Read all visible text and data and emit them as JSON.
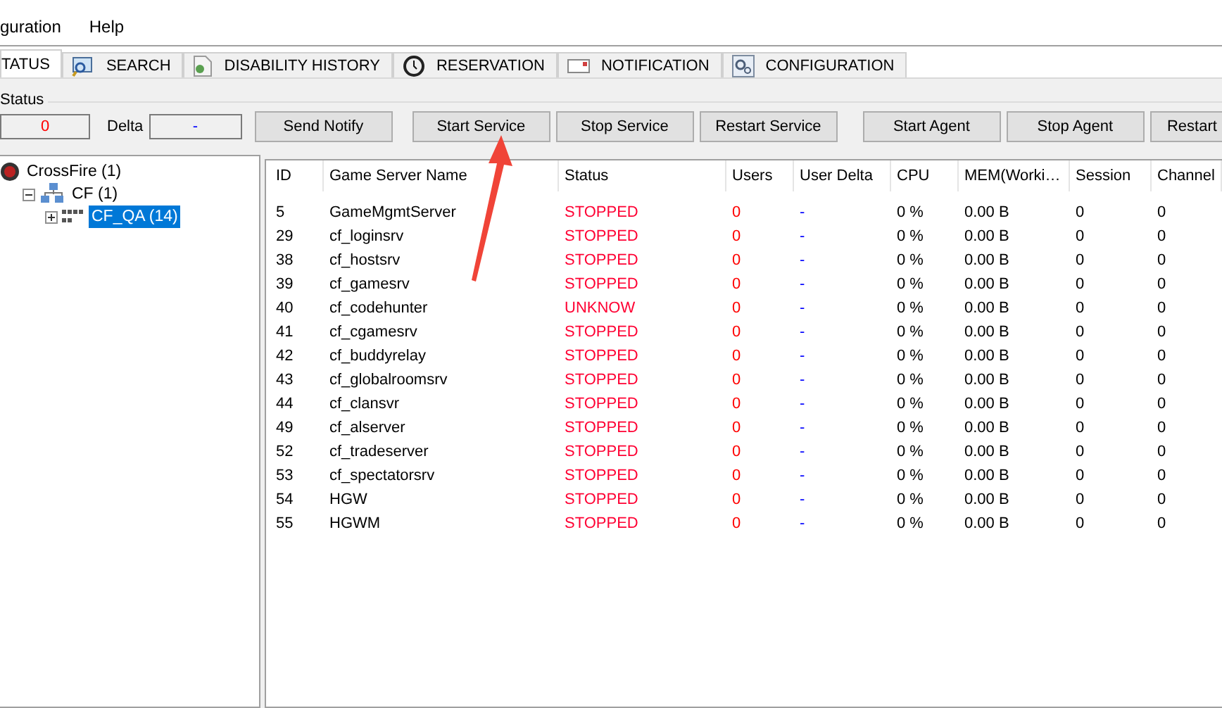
{
  "menu": [
    "guration",
    "Help"
  ],
  "tabs": [
    {
      "label": "TATUS",
      "selected": true
    },
    {
      "label": "SEARCH",
      "selected": false
    },
    {
      "label": "DISABILITY HISTORY",
      "selected": false
    },
    {
      "label": "RESERVATION",
      "selected": false
    },
    {
      "label": "NOTIFICATION",
      "selected": false
    },
    {
      "label": "CONFIGURATION",
      "selected": false
    }
  ],
  "status_group": {
    "title": "Status",
    "count": "0",
    "delta_label": "Delta",
    "delta": "-"
  },
  "buttons": [
    "Send Notify",
    "Start Service",
    "Stop Service",
    "Restart Service",
    "Start Agent",
    "Stop Agent",
    "Restart"
  ],
  "tree": [
    {
      "label": "CrossFire (1)",
      "selected": false,
      "children": [
        {
          "label": "CF (1)",
          "expanded": true,
          "selected": false,
          "children": [
            {
              "label": "CF_QA (14)",
              "expanded": false,
              "selected": true
            }
          ]
        }
      ]
    }
  ],
  "table": {
    "columns": [
      "ID",
      "Game Server Name",
      "Status",
      "Users",
      "User Delta",
      "CPU",
      "MEM(Worki…",
      "Session",
      "Channel"
    ],
    "rows": [
      [
        "5",
        "GameMgmtServer",
        "STOPPED",
        "0",
        "-",
        "0 %",
        "0.00 B",
        "0",
        "0"
      ],
      [
        "29",
        "cf_loginsrv",
        "STOPPED",
        "0",
        "-",
        "0 %",
        "0.00 B",
        "0",
        "0"
      ],
      [
        "38",
        "cf_hostsrv",
        "STOPPED",
        "0",
        "-",
        "0 %",
        "0.00 B",
        "0",
        "0"
      ],
      [
        "39",
        "cf_gamesrv",
        "STOPPED",
        "0",
        "-",
        "0 %",
        "0.00 B",
        "0",
        "0"
      ],
      [
        "40",
        "cf_codehunter",
        "UNKNOW",
        "0",
        "-",
        "0 %",
        "0.00 B",
        "0",
        "0"
      ],
      [
        "41",
        "cf_cgamesrv",
        "STOPPED",
        "0",
        "-",
        "0 %",
        "0.00 B",
        "0",
        "0"
      ],
      [
        "42",
        "cf_buddyrelay",
        "STOPPED",
        "0",
        "-",
        "0 %",
        "0.00 B",
        "0",
        "0"
      ],
      [
        "43",
        "cf_globalroomsrv",
        "STOPPED",
        "0",
        "-",
        "0 %",
        "0.00 B",
        "0",
        "0"
      ],
      [
        "44",
        "cf_clansvr",
        "STOPPED",
        "0",
        "-",
        "0 %",
        "0.00 B",
        "0",
        "0"
      ],
      [
        "49",
        "cf_alserver",
        "STOPPED",
        "0",
        "-",
        "0 %",
        "0.00 B",
        "0",
        "0"
      ],
      [
        "52",
        "cf_tradeserver",
        "STOPPED",
        "0",
        "-",
        "0 %",
        "0.00 B",
        "0",
        "0"
      ],
      [
        "53",
        "cf_spectatorsrv",
        "STOPPED",
        "0",
        "-",
        "0 %",
        "0.00 B",
        "0",
        "0"
      ],
      [
        "54",
        "HGW",
        "STOPPED",
        "0",
        "-",
        "0 %",
        "0.00 B",
        "0",
        "0"
      ],
      [
        "55",
        "HGWM",
        "STOPPED",
        "0",
        "-",
        "0 %",
        "0.00 B",
        "0",
        "0"
      ]
    ]
  }
}
